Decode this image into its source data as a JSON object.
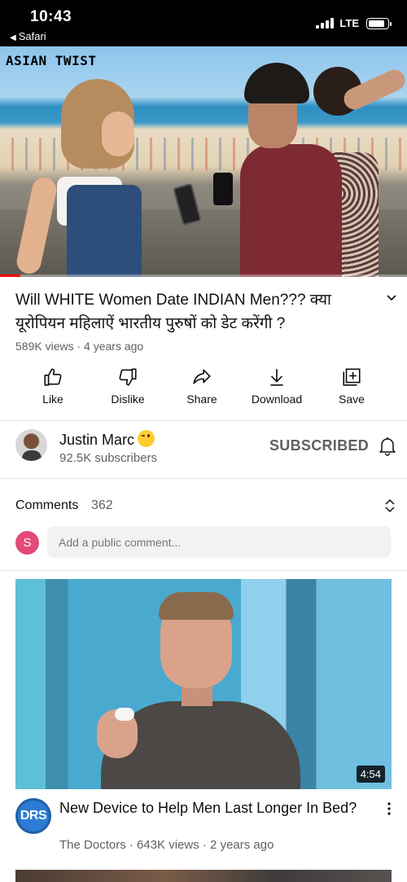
{
  "status_bar": {
    "time": "10:43",
    "back_label": "Safari",
    "network": "LTE"
  },
  "video": {
    "overlay_text": "ASIAN TWIST",
    "progress_percent": 5
  },
  "details": {
    "title": "Will WHITE Women Date INDIAN Men??? क्या यूरोपियन महिलाऐं भारतीय पुरुषों को डेट करेंगी ?",
    "views": "589K views",
    "age": "4 years ago",
    "meta_separator": " · "
  },
  "actions": {
    "like": "Like",
    "dislike": "Dislike",
    "share": "Share",
    "download": "Download",
    "save": "Save"
  },
  "channel": {
    "name": "Justin Marc",
    "subscribers": "92.5K subscribers",
    "subscribe_state": "SUBSCRIBED"
  },
  "comments": {
    "label": "Comments",
    "count": "362",
    "user_initial": "S",
    "placeholder": "Add a public comment..."
  },
  "recommended": {
    "duration": "4:54",
    "channel_logo_text": "DRS",
    "title": "New Device to Help Men Last Longer In Bed?",
    "meta": "The Doctors · 643K views · 2 years ago"
  },
  "colors": {
    "accent_red": "#ff0000",
    "secondary_text": "#606060",
    "comment_avatar": "#e34a78"
  }
}
